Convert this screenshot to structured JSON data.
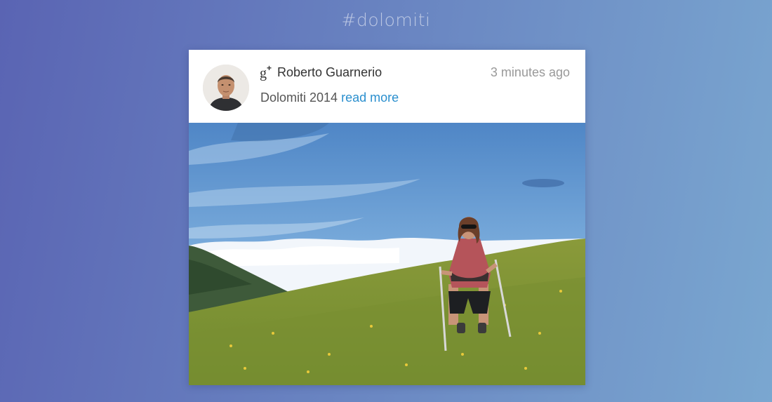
{
  "header": {
    "hashtag": "#dolomiti"
  },
  "post": {
    "network_icon": "google-plus-icon",
    "author": "Roberto Guarnerio",
    "timestamp": "3 minutes ago",
    "text": "Dolomiti 2014",
    "read_more_label": "read more"
  },
  "colors": {
    "background_start": "#5a64b3",
    "background_end": "#7aa7d0",
    "link": "#2a8fce"
  }
}
